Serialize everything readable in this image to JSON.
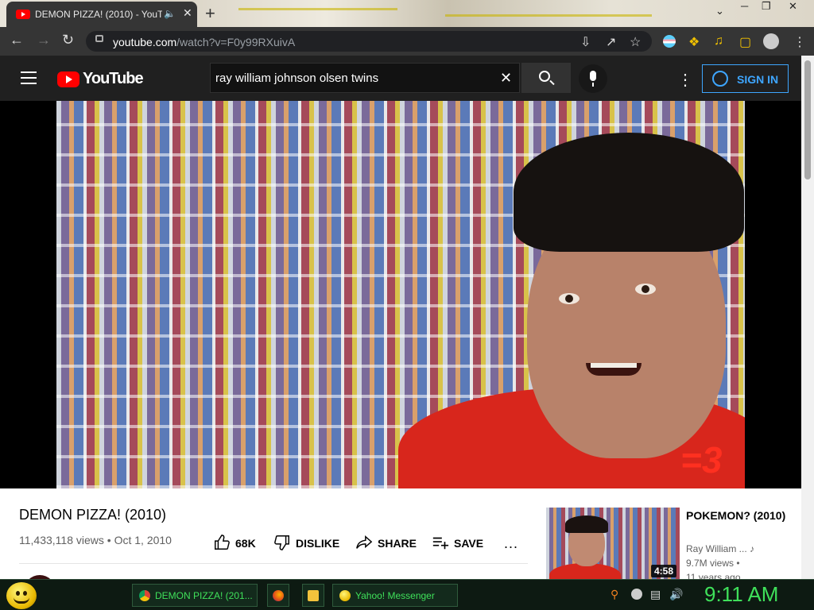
{
  "browser": {
    "tab_title": "DEMON PIZZA! (2010) - YouTube",
    "url_host": "youtube.com",
    "url_path": "/watch?v=F0y99RXuivA",
    "new_tab_icon": "+"
  },
  "youtube": {
    "logo_text": "YouTube",
    "search_value": "ray william johnson olsen twins",
    "sign_in_label": "SIGN IN"
  },
  "video": {
    "watermark": "=3",
    "title": "DEMON PIZZA! (2010)",
    "views": "11,433,118 views",
    "date": "Oct 1, 2010",
    "meta_sep": " • ",
    "like_count": "68K",
    "dislike_label": "DISLIKE",
    "share_label": "SHARE",
    "save_label": "SAVE",
    "more_label": "..."
  },
  "related": {
    "title": "POKEMON? (2010)",
    "channel": "Ray William ...",
    "views": "9.7M views •",
    "age": "11 years ago",
    "duration": "4:58"
  },
  "taskbar": {
    "tasks": [
      {
        "label": "DEMON PIZZA! (201..."
      },
      {
        "label": "Yahoo! Messenger"
      }
    ],
    "clock": "9:11 AM"
  },
  "colors": {
    "youtube_red": "#ff0000",
    "link_blue": "#3ea6ff",
    "clock_green": "#3fe05a"
  }
}
